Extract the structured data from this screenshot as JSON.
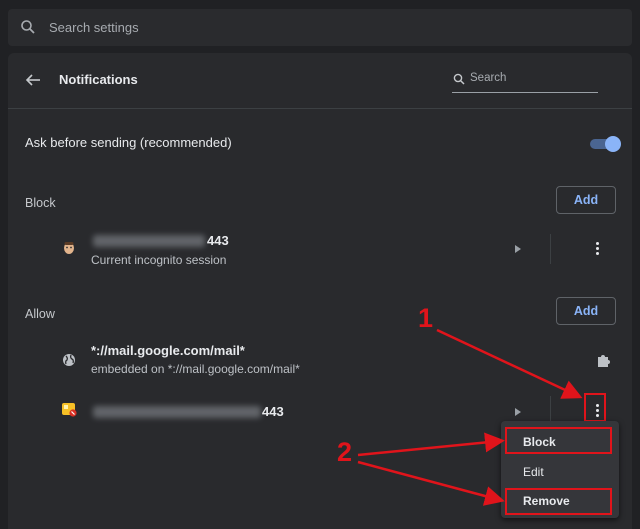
{
  "top_search": {
    "placeholder": "Search settings"
  },
  "header": {
    "title": "Notifications",
    "search_placeholder": "Search"
  },
  "ask_setting": {
    "label": "Ask before sending (recommended)",
    "enabled": true
  },
  "block_section": {
    "title": "Block",
    "add_label": "Add",
    "sites": [
      {
        "url_suffix": "443",
        "subtitle": "Current incognito session"
      }
    ]
  },
  "allow_section": {
    "title": "Allow",
    "add_label": "Add",
    "sites": [
      {
        "url": "*://mail.google.com/mail*",
        "subtitle": "embedded on *://mail.google.com/mail*"
      },
      {
        "url_suffix": "443"
      }
    ]
  },
  "context_menu": {
    "items": [
      "Block",
      "Edit",
      "Remove"
    ]
  },
  "annotations": {
    "one": "1",
    "two": "2"
  },
  "colors": {
    "accent": "#8ab4f8",
    "annotation_red": "#e0141b",
    "toggle_knob": "#8ab4f8",
    "toggle_track": "#4a6591"
  }
}
